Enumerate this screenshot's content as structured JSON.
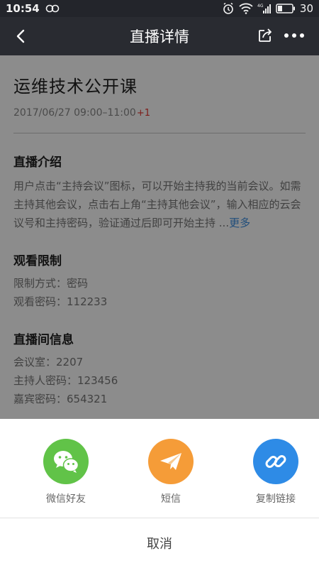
{
  "status_bar": {
    "time": "10:54",
    "battery_level": "30",
    "network_label": "4G"
  },
  "nav": {
    "title": "直播详情",
    "back_icon": "chevron-left-icon",
    "share_icon": "share-icon",
    "more_icon": "more-icon"
  },
  "live": {
    "title": "运维技术公开课",
    "date_time": "2017/06/27  09:00–11:00",
    "plus_days": "+1"
  },
  "intro": {
    "heading": "直播介绍",
    "text": "用户点击“主持会议”图标，可以开始主持我的当前会议。如需主持其他会议，点击右上角“主持其他会议”，输入相应的云会议号和主持密码，验证通过后即可开始主持",
    "ellipsis": " ...",
    "more": "更多"
  },
  "restriction": {
    "heading": "观看限制",
    "method": "限制方式：密码",
    "password": "观看密码：112233"
  },
  "room": {
    "heading": "直播间信息",
    "meeting_room": "会议室：2207",
    "host_password": "主持人密码：123456",
    "guest_password": "嘉宾密码：654321"
  },
  "share_sheet": {
    "options": [
      {
        "label": "微信好友",
        "icon": "wechat-icon",
        "color": "#61c348"
      },
      {
        "label": "短信",
        "icon": "paper-plane-icon",
        "color": "#f59c38"
      },
      {
        "label": "复制链接",
        "icon": "link-icon",
        "color": "#2e8be6"
      }
    ],
    "cancel": "取消"
  }
}
